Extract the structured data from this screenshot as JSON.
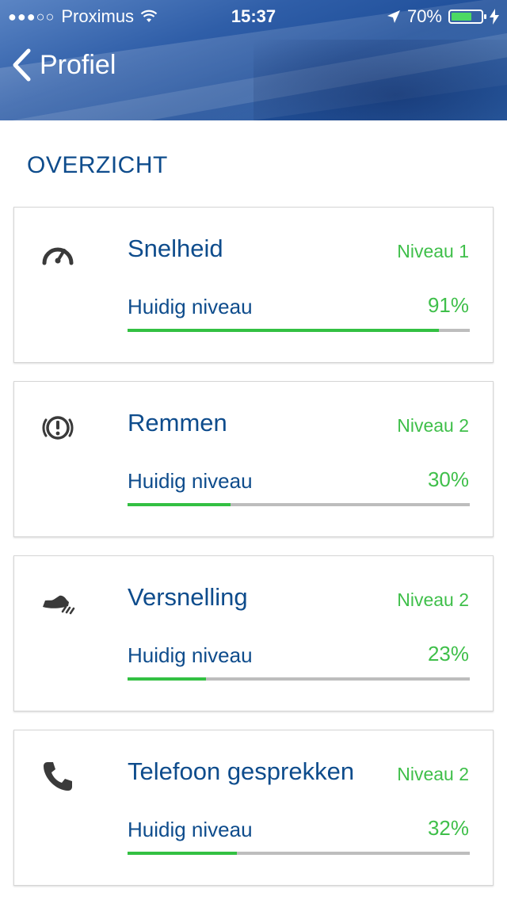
{
  "status_bar": {
    "signal_dots": "●●●○○",
    "carrier": "Proximus",
    "time": "15:37",
    "battery_percent": "70%",
    "battery_level": 0.7
  },
  "nav": {
    "back_label": "Profiel"
  },
  "section": {
    "title": "OVERZICHT"
  },
  "colors": {
    "primary_blue": "#0e4c8c",
    "green": "#3fbf4a",
    "bar_bg": "#bdbdbd"
  },
  "cards": [
    {
      "icon": "speedometer-icon",
      "name": "Snelheid",
      "level": "Niveau 1",
      "current_label": "Huidig niveau",
      "percent": "91%",
      "progress": 0.91
    },
    {
      "icon": "brake-warning-icon",
      "name": "Remmen",
      "level": "Niveau 2",
      "current_label": "Huidig niveau",
      "percent": "30%",
      "progress": 0.3
    },
    {
      "icon": "acceleration-shoe-icon",
      "name": "Versnelling",
      "level": "Niveau 2",
      "current_label": "Huidig niveau",
      "percent": "23%",
      "progress": 0.23
    },
    {
      "icon": "phone-icon",
      "name": "Telefoon gesprekken",
      "level": "Niveau 2",
      "current_label": "Huidig niveau",
      "percent": "32%",
      "progress": 0.32
    }
  ]
}
